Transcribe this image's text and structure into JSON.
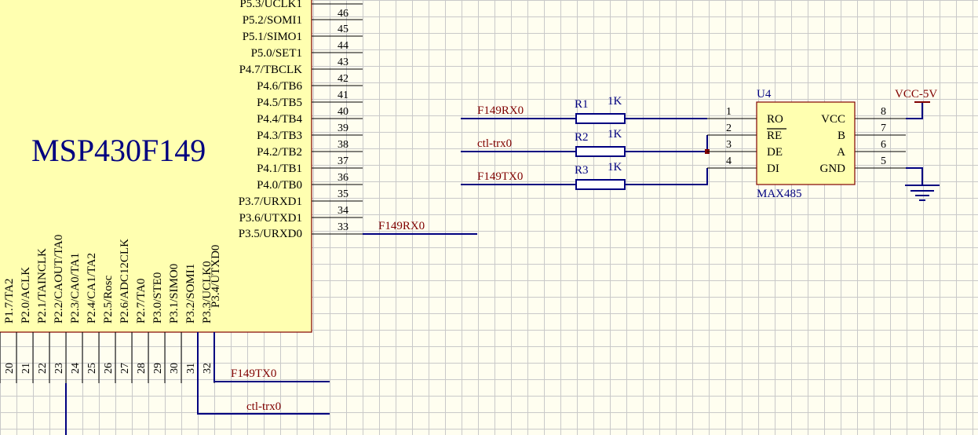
{
  "mcu": {
    "name": "MSP430F149",
    "right_pins": [
      {
        "num": "46",
        "label": "P5.3/UCLK1"
      },
      {
        "num": "45",
        "label": "P5.2/SOMI1"
      },
      {
        "num": "44",
        "label": "P5.1/SIMO1"
      },
      {
        "num": "43",
        "label": "P5.0/SET1"
      },
      {
        "num": "42",
        "label": "P4.7/TBCLK"
      },
      {
        "num": "41",
        "label": "P4.6/TB6"
      },
      {
        "num": "40",
        "label": "P4.5/TB5"
      },
      {
        "num": "39",
        "label": "P4.4/TB4"
      },
      {
        "num": "38",
        "label": "P4.3/TB3"
      },
      {
        "num": "37",
        "label": "P4.2/TB2"
      },
      {
        "num": "36",
        "label": "P4.1/TB1"
      },
      {
        "num": "35",
        "label": "P4.0/TB0"
      },
      {
        "num": "34",
        "label": "P3.7/URXD1"
      },
      {
        "num": "33",
        "label": "P3.6/UTXD1"
      },
      {
        "num": "33",
        "label": "P3.5/URXD0"
      }
    ],
    "bottom_pins": [
      {
        "num": "20",
        "label": "P1.7/TA2"
      },
      {
        "num": "21",
        "label": "P2.0/ACLK"
      },
      {
        "num": "22",
        "label": "P2.1/TAINCLK"
      },
      {
        "num": "23",
        "label": "P2.2/CAOUT/TA0"
      },
      {
        "num": "24",
        "label": "P2.3/CA0/TA1"
      },
      {
        "num": "25",
        "label": "P2.4/CA1/TA2"
      },
      {
        "num": "26",
        "label": "P2.5/Rosc"
      },
      {
        "num": "27",
        "label": "P2.6/ADC12CLK"
      },
      {
        "num": "28",
        "label": "P2.7/TA0"
      },
      {
        "num": "29",
        "label": "P3.0/STE0"
      },
      {
        "num": "30",
        "label": "P3.1/SIMO0"
      },
      {
        "num": "31",
        "label": "P3.2/SOMI1"
      },
      {
        "num": "32",
        "label": "P3.3/UCLK0"
      },
      {
        "num": "",
        "label": "P3.4/UTXD0"
      }
    ]
  },
  "nets": {
    "mcu_p35": "F149RX0",
    "bottom_tx": "F149TX0",
    "bottom_ctl": "ctl-trx0",
    "left_rx": "F149RX0",
    "left_ctl": "ctl-trx0",
    "left_tx": "F149TX0",
    "vcc": "VCC-5V"
  },
  "resistors": [
    {
      "ref": "R1",
      "value": "1K"
    },
    {
      "ref": "R2",
      "value": "1K"
    },
    {
      "ref": "R3",
      "value": "1K"
    }
  ],
  "max485": {
    "ref": "U4",
    "name": "MAX485",
    "left_pins": [
      {
        "num": "1",
        "label": "RO"
      },
      {
        "num": "2",
        "label": "RE"
      },
      {
        "num": "3",
        "label": "DE"
      },
      {
        "num": "4",
        "label": "DI"
      }
    ],
    "right_pins": [
      {
        "num": "8",
        "label": "VCC"
      },
      {
        "num": "7",
        "label": "B"
      },
      {
        "num": "6",
        "label": "A"
      },
      {
        "num": "5",
        "label": "GND"
      }
    ]
  },
  "colors": {
    "wire": "#000080",
    "net_label": "#800000",
    "component_fill": "#ffffb0",
    "grid": "#c9c9c9",
    "background": "#fffef0"
  }
}
